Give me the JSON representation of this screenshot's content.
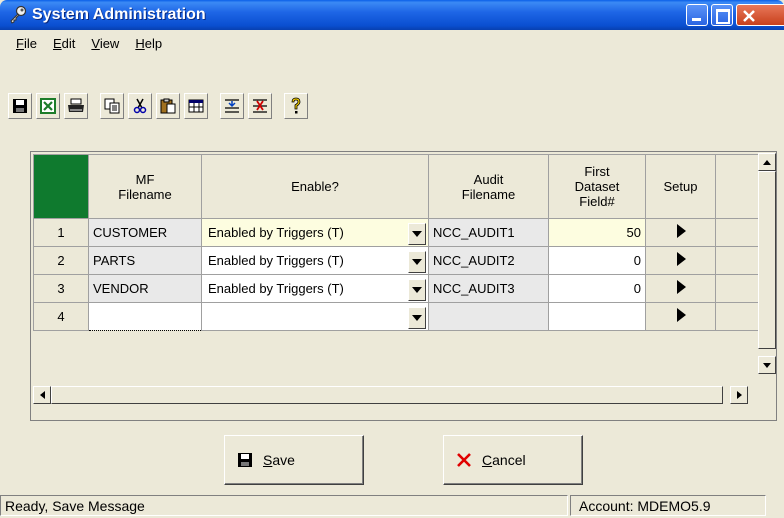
{
  "window": {
    "title": "System Administration",
    "icon": "key-icon"
  },
  "menu": [
    {
      "label": "File",
      "accel": "F"
    },
    {
      "label": "Edit",
      "accel": "E"
    },
    {
      "label": "View",
      "accel": "V"
    },
    {
      "label": "Help",
      "accel": "H"
    }
  ],
  "toolbar": {
    "icons": [
      "save-icon",
      "excel-icon",
      "print-icon",
      "copy-icon",
      "cut-icon",
      "paste-icon",
      "grid-icon",
      "indent-icon",
      "delete-row-icon",
      "help-icon"
    ]
  },
  "grid": {
    "headers": {
      "mf_line1": "MF",
      "mf_line2": "Filename",
      "enable": "Enable?",
      "audit_line1": "Audit",
      "audit_line2": "Filename",
      "field_line1": "First",
      "field_line2": "Dataset",
      "field_line3": "Field#",
      "setup": "Setup"
    },
    "rows": [
      {
        "num": "1",
        "mf": "CUSTOMER",
        "enable": "Enabled by Triggers (T)",
        "audit": "NCC_AUDIT1",
        "field": "50"
      },
      {
        "num": "2",
        "mf": "PARTS",
        "enable": "Enabled by Triggers (T)",
        "audit": "NCC_AUDIT2",
        "field": "0"
      },
      {
        "num": "3",
        "mf": "VENDOR",
        "enable": "Enabled by Triggers (T)",
        "audit": "NCC_AUDIT3",
        "field": "0"
      },
      {
        "num": "4",
        "mf": "",
        "enable": "",
        "audit": "",
        "field": ""
      }
    ]
  },
  "buttons": {
    "save": "Save",
    "save_accel": "S",
    "cancel": "Cancel",
    "cancel_accel": "C"
  },
  "status": {
    "message": "Ready, Save Message",
    "account": "Account: MDEMO5.9"
  },
  "colors": {
    "title_bar": "#0a4fd1",
    "header_corner": "#0f7a2e",
    "selected_row": "#fdfde0"
  }
}
